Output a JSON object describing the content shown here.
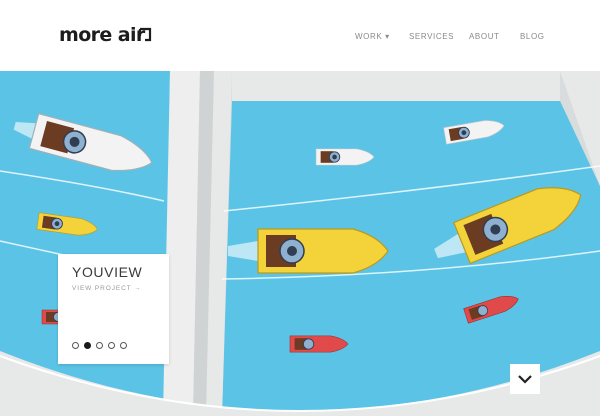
{
  "header": {
    "logo_text": "more air",
    "nav": [
      {
        "label": "WORK ▾"
      },
      {
        "label": "SERVICES"
      },
      {
        "label": "ABOUT"
      },
      {
        "label": "BLOG"
      }
    ]
  },
  "hero": {
    "project_title": "YOUVIEW",
    "project_link": "VIEW PROJECT →",
    "slides": {
      "count": 5,
      "active_index": 1
    },
    "scroll_icon": "chevron-down-icon"
  },
  "colors": {
    "water": "#5bc4e6",
    "dock": "#e7e8e8",
    "boat_white": "#f2f2f2",
    "boat_yellow": "#f4d23a",
    "boat_red": "#e04a4a",
    "text_dark": "#1d1d1d"
  }
}
